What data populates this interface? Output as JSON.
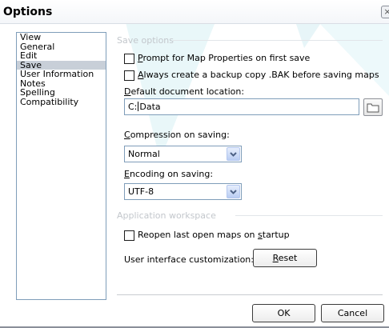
{
  "window": {
    "title": "Options",
    "close_icon": "×"
  },
  "nav": {
    "items": [
      {
        "label": "View"
      },
      {
        "label": "General"
      },
      {
        "label": "Edit"
      },
      {
        "label": "Save",
        "selected": true
      },
      {
        "label": "User Information"
      },
      {
        "label": "Notes"
      },
      {
        "label": "Spelling"
      },
      {
        "label": "Compatibility"
      }
    ]
  },
  "save_options": {
    "group_label": "Save options",
    "prompt_map_properties": {
      "checked": false,
      "accel": "P",
      "rest": "rompt for Map Properties on first save"
    },
    "backup_copy": {
      "checked": false,
      "accel": "A",
      "rest": "lways create a backup copy .BAK before saving maps"
    },
    "default_location": {
      "accel": "D",
      "rest": "efault document location:",
      "value_before": "C:",
      "value_after": "Data"
    },
    "compression": {
      "accel": "C",
      "rest": "ompression on saving:",
      "value": "Normal"
    },
    "encoding": {
      "accel": "E",
      "rest": "ncoding on saving:",
      "value": "UTF-8"
    }
  },
  "workspace": {
    "group_label": "Application workspace",
    "reopen_maps": {
      "checked": false,
      "before": "Reopen last open maps on ",
      "accel": "s",
      "after": "tartup"
    },
    "ui_customization_label": "User interface customization:",
    "reset_button": {
      "accel": "R",
      "rest": "eset"
    }
  },
  "footer": {
    "ok_label": "OK",
    "cancel_label": "Cancel"
  },
  "icons": {
    "folder": "folder-icon",
    "dropdown": "chevron-down-icon",
    "close": "close-icon"
  }
}
